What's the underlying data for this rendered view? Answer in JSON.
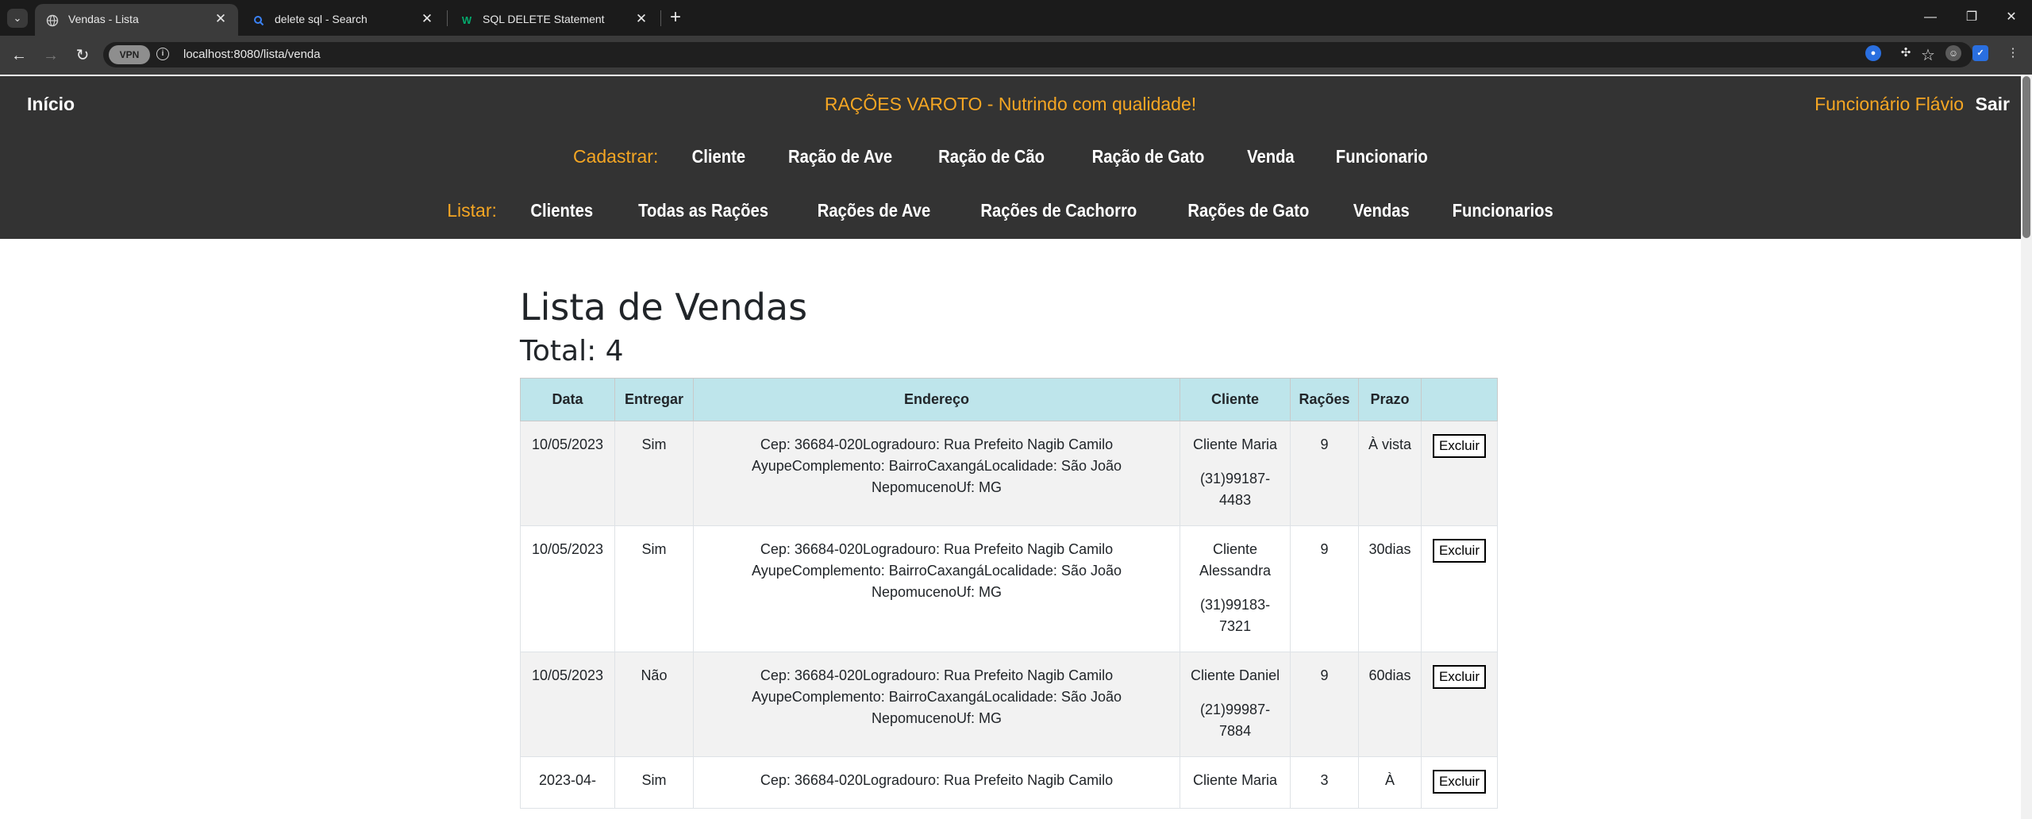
{
  "browser": {
    "tabs": [
      {
        "title": "Vendas - Lista",
        "icon": "globe-icon",
        "active": true
      },
      {
        "title": "delete sql - Search",
        "icon": "search-icon",
        "active": false
      },
      {
        "title": "SQL DELETE Statement",
        "icon": "w3schools-icon",
        "active": false
      }
    ],
    "url": "localhost:8080/lista/venda",
    "vpn_label": "VPN"
  },
  "header": {
    "home": "Início",
    "brand": "RAÇÕES VAROTO - Nutrindo com qualidade!",
    "user": "Funcionário Flávio",
    "logout": "Sair",
    "cadastrar_label": "Cadastrar:",
    "cadastrar_links": [
      "Cliente",
      "Ração de Ave",
      "Ração de Cão",
      "Ração de Gato",
      "Venda",
      "Funcionario"
    ],
    "listar_label": "Listar:",
    "listar_links": [
      "Clientes",
      "Todas as Rações",
      "Rações de Ave",
      "Rações de Cachorro",
      "Rações de Gato",
      "Vendas",
      "Funcionarios"
    ]
  },
  "main": {
    "title": "Lista de Vendas",
    "total": "Total: 4",
    "columns": [
      "Data",
      "Entregar",
      "Endereço",
      "Cliente",
      "Rações",
      "Prazo",
      ""
    ],
    "rows": [
      {
        "data": "10/05/2023",
        "entregar": "Sim",
        "endereco": "Cep: 36684-020Logradouro: Rua Prefeito Nagib Camilo AyupeComplemento: BairroCaxangáLocalidade: São João NepomucenoUf: MG",
        "cliente": "Cliente Maria",
        "telefone": "(31)99187-4483",
        "racoes": "9",
        "prazo": "À vista",
        "acao": "Excluir"
      },
      {
        "data": "10/05/2023",
        "entregar": "Sim",
        "endereco": "Cep: 36684-020Logradouro: Rua Prefeito Nagib Camilo AyupeComplemento: BairroCaxangáLocalidade: São João NepomucenoUf: MG",
        "cliente": "Cliente Alessandra",
        "telefone": "(31)99183-7321",
        "racoes": "9",
        "prazo": "30dias",
        "acao": "Excluir"
      },
      {
        "data": "10/05/2023",
        "entregar": "Não",
        "endereco": "Cep: 36684-020Logradouro: Rua Prefeito Nagib Camilo AyupeComplemento: BairroCaxangáLocalidade: São João NepomucenoUf: MG",
        "cliente": "Cliente Daniel",
        "telefone": "(21)99987-7884",
        "racoes": "9",
        "prazo": "60dias",
        "acao": "Excluir"
      },
      {
        "data": "2023-04-",
        "entregar": "Sim",
        "endereco": "Cep: 36684-020Logradouro: Rua Prefeito Nagib Camilo",
        "cliente": "Cliente Maria",
        "telefone": "",
        "racoes": "3",
        "prazo": "À",
        "acao": "Excluir"
      }
    ]
  },
  "colors": {
    "header_bg": "#333333",
    "accent_orange": "#f5a623",
    "table_header_bg": "#bee5eb",
    "row_stripe": "#f2f2f2"
  }
}
